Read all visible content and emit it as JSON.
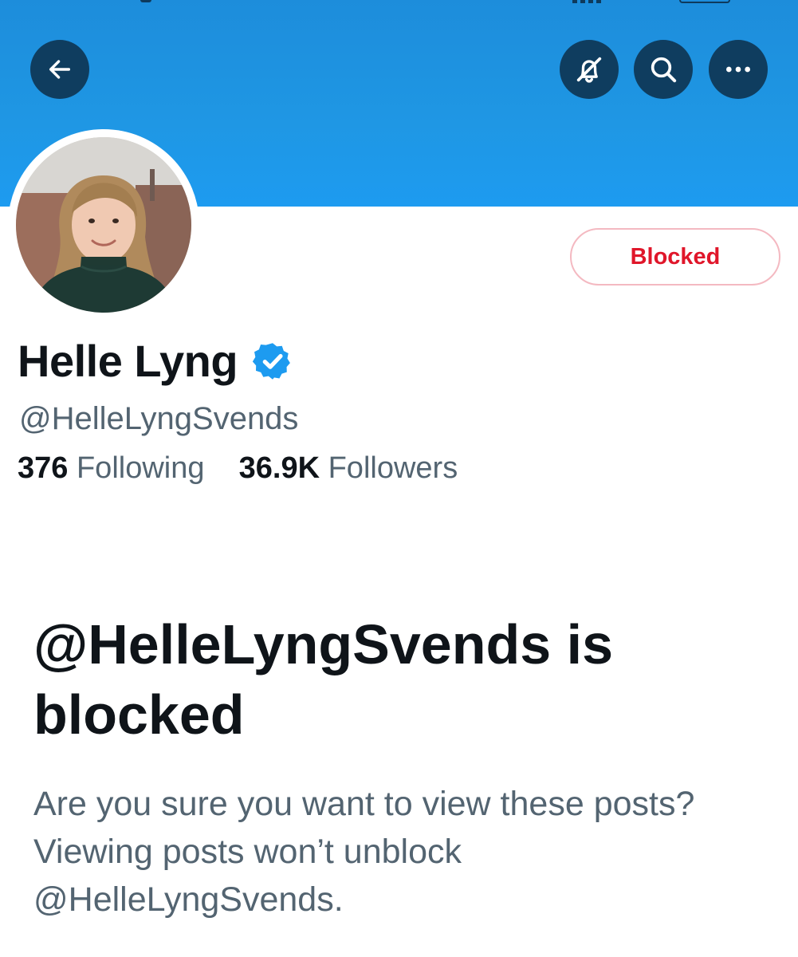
{
  "header": {
    "back_icon": "arrow-left-icon",
    "notifications_icon": "notifications-off-icon",
    "search_icon": "search-icon",
    "more_icon": "more-horizontal-icon",
    "banner_color": "#1d9bf0",
    "button_color": "#0f3d5f"
  },
  "profile": {
    "display_name": "Helle Lyng",
    "verified_icon": "verified-badge-icon",
    "handle": "@HelleLyngSvends",
    "following_count": "376",
    "following_label": "Following",
    "followers_count": "36.9K",
    "followers_label": "Followers",
    "blocked_button_label": "Blocked",
    "blocked_color": "#e0162a"
  },
  "blocked_notice": {
    "title": "@HelleLyngSvends is blocked",
    "description": "Are you sure you want to view these posts? Viewing posts won’t unblock @HelleLyngSvends."
  }
}
